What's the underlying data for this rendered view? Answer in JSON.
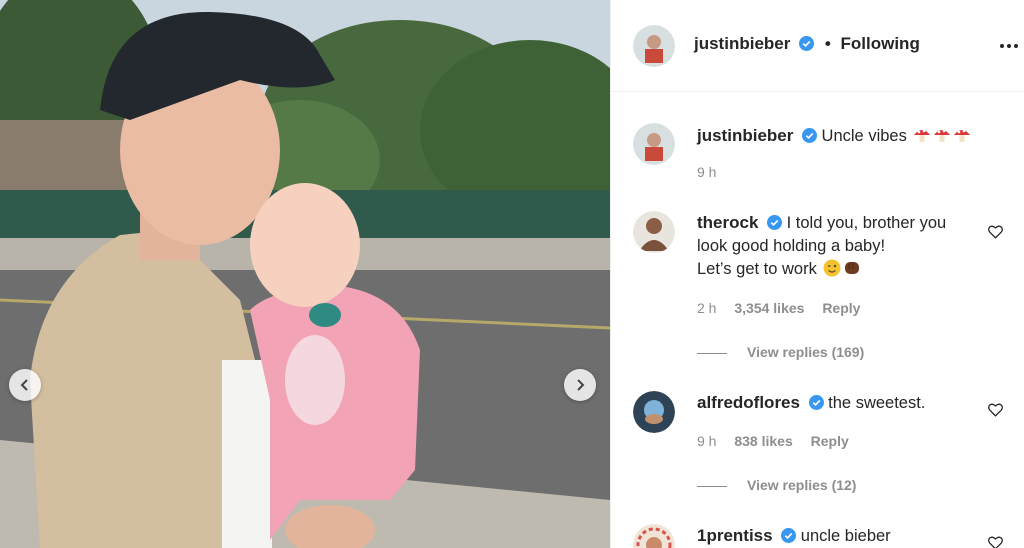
{
  "post": {
    "author": "justinbieber",
    "follow_status": "Following",
    "separator": "•"
  },
  "caption": {
    "username": "justinbieber",
    "text": "Uncle vibes",
    "emojis": [
      "mushroom-icon",
      "mushroom-icon",
      "mushroom-icon"
    ],
    "time": "9 h"
  },
  "comments": [
    {
      "username": "therock",
      "verified": true,
      "line1": "I told you, brother you look good holding a baby!",
      "line2": "Let’s get to work",
      "emojis": [
        "winking-face-icon",
        "fist-icon"
      ],
      "time": "2 h",
      "likes": "3,354 likes",
      "reply": "Reply",
      "view_replies": "View replies (169)"
    },
    {
      "username": "alfredoflores",
      "verified": true,
      "line1": "the sweetest.",
      "time": "9 h",
      "likes": "838 likes",
      "reply": "Reply",
      "view_replies": "View replies (12)"
    },
    {
      "username": "1prentiss",
      "verified": true,
      "line1": "uncle bieber"
    }
  ],
  "colors": {
    "verified": "#3897f0",
    "meta": "#8e8e8e",
    "text": "#262626"
  }
}
